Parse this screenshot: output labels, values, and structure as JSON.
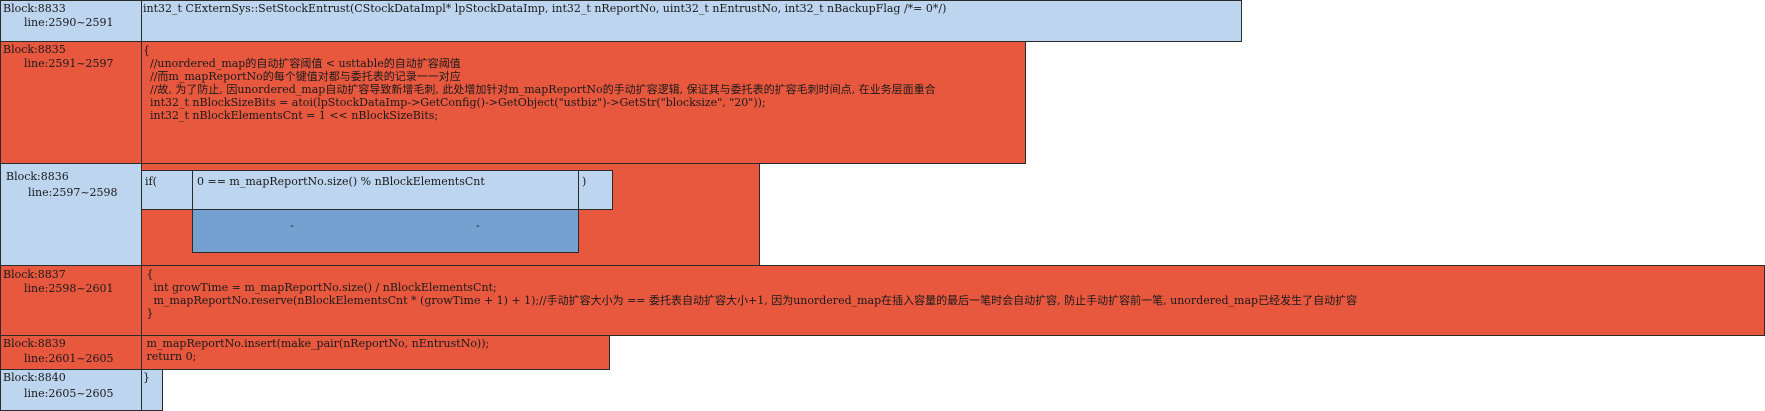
{
  "blocks": [
    {
      "name": "Block:8833",
      "lines": "line:2590~2591",
      "code": "int32_t CExternSys::SetStockEntrust(CStockDataImpl* lpStockDataImp, int32_t nReportNo, uint32_t nEntrustNo, int32_t nBackupFlag /*= 0*/)"
    },
    {
      "name": "Block:8835",
      "lines": "line:2591~2597",
      "code": "{\n  //unordered_map的自动扩容阈值 < usttable的自动扩容阈值\n  //而m_mapReportNo的每个键值对都与委托表的记录一一对应\n  //故, 为了防止, 因unordered_map自动扩容导致新增毛刺, 此处增加针对m_mapReportNo的手动扩容逻辑, 保证其与委托表的扩容毛刺时间点, 在业务层面重合\n  int32_t nBlockSizeBits = atoi(lpStockDataImp->GetConfig()->GetObject(\"ustbiz\")->GetStr(\"blocksize\", \"20\"));\n  int32_t nBlockElementsCnt = 1 << nBlockSizeBits;"
    },
    {
      "name": "Block:8836",
      "lines": "line:2597~2598",
      "if_kw": "if(",
      "cond": "0 == m_mapReportNo.size() % nBlockElementsCnt",
      "close_paren": ")",
      "branch_left": "-",
      "branch_right": "-"
    },
    {
      "name": "Block:8837",
      "lines": "line:2598~2601",
      "code": " {\n   int growTime = m_mapReportNo.size() / nBlockElementsCnt;\n   m_mapReportNo.reserve(nBlockElementsCnt * (growTime + 1) + 1);//手动扩容大小为 == 委托表自动扩容大小+1, 因为unordered_map在插入容量的最后一笔时会自动扩容, 防止手动扩容前一笔, unordered_map已经发生了自动扩容\n }"
    },
    {
      "name": "Block:8839",
      "lines": "line:2601~2605",
      "code": " m_mapReportNo.insert(make_pair(nReportNo, nEntrustNo));\n return 0;"
    },
    {
      "name": "Block:8840",
      "lines": "line:2605~2605",
      "code": "}"
    }
  ],
  "colors": {
    "blue": "#bdd5ef",
    "red": "#e8583f",
    "mid_blue": "#74a1cf",
    "border": "#2b2b2b"
  }
}
